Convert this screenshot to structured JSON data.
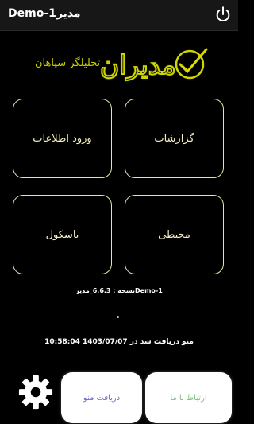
{
  "header": {
    "title": "مدیرDemo-1",
    "power_icon": "power-icon"
  },
  "logo": {
    "name": "مدیران",
    "tagline": "تحلیلگر سپاهان",
    "color": "#cfd600",
    "mark_icon": "check-swoosh-icon"
  },
  "tiles": [
    {
      "label": "ورود اطلاعات"
    },
    {
      "label": "گزارشات"
    },
    {
      "label": "باسکول"
    },
    {
      "label": "محیطی"
    }
  ],
  "version_text": "نسخه : 6.6.3_مدیرDemo-1",
  "separator_dot": ".",
  "menu_received_text": "منو دریافت شد در 1403/07/07 10:58:04",
  "bottom": {
    "settings_icon": "gear-icon",
    "receive_menu_label": "دریافت منو",
    "contact_label": "ارتباط با ما"
  },
  "colors": {
    "tile_border": "#e8e69a",
    "tile_text": "#f3f0be",
    "background": "#000000"
  }
}
